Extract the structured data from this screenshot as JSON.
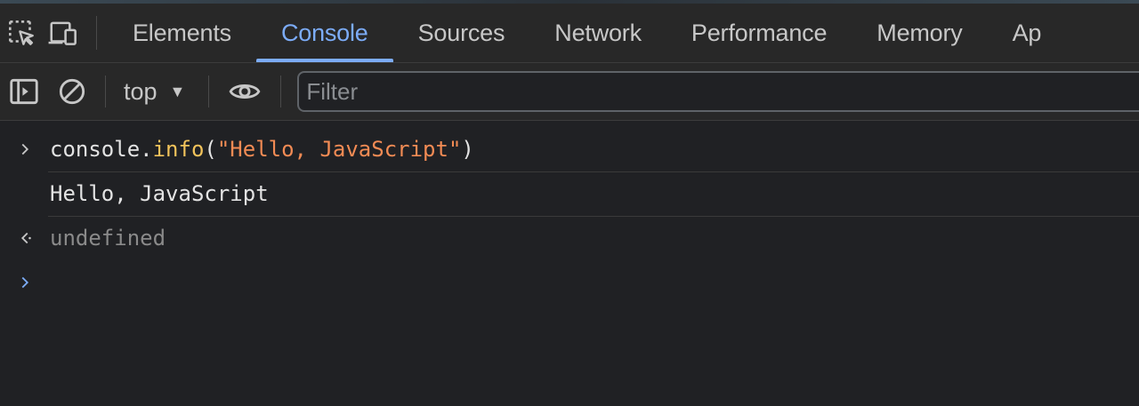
{
  "tabs": [
    {
      "label": "Elements",
      "active": false
    },
    {
      "label": "Console",
      "active": true
    },
    {
      "label": "Sources",
      "active": false
    },
    {
      "label": "Network",
      "active": false
    },
    {
      "label": "Performance",
      "active": false
    },
    {
      "label": "Memory",
      "active": false
    },
    {
      "label": "Ap",
      "active": false
    }
  ],
  "toolbar": {
    "context": "top",
    "filter_placeholder": "Filter",
    "filter_value": ""
  },
  "console": {
    "input": {
      "object": "console",
      "dot": ".",
      "method": "info",
      "open": "(",
      "string": "\"Hello, JavaScript\"",
      "close": ")"
    },
    "output": "Hello, JavaScript",
    "return_value": "undefined"
  },
  "colors": {
    "accent": "#7cacf8",
    "method": "#f2c35b",
    "string": "#f28b54",
    "muted": "#8a8a8a"
  }
}
